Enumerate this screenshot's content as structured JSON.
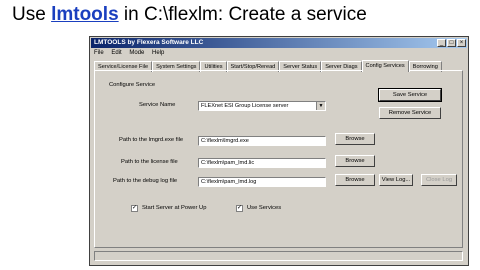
{
  "heading": {
    "prefix": "Use ",
    "link": "lmtools",
    "suffix": " in C:\\flexlm: Create a service"
  },
  "window": {
    "title": "LMTOOLS by Flexera Software LLC",
    "controls": {
      "minimize": "_",
      "maximize": "□",
      "close": "×"
    }
  },
  "menu": [
    "File",
    "Edit",
    "Mode",
    "Help"
  ],
  "tabs": [
    "Service/License File",
    "System Settings",
    "Utilities",
    "Start/Stop/Reread",
    "Server Status",
    "Server Diags",
    "Config Services",
    "Borrowing"
  ],
  "active_tab": "Config Services",
  "config": {
    "group_label": "Configure Service",
    "service_name_label": "Service Name",
    "service_name_value": "FLEXnet ESI Group License server",
    "lmgrd_label": "Path to the lmgrd.exe file",
    "lmgrd_value": "C:\\flexlm\\lmgrd.exe",
    "license_label": "Path to the license file",
    "license_value": "C:\\flexlm\\pam_lmd.lic",
    "debug_label": "Path to the debug log file",
    "debug_value": "C:\\flexlm\\pam_lmd.log",
    "save_service": "Save Service",
    "remove_service": "Remove Service",
    "browse": "Browse",
    "view_log": "View Log...",
    "close_log": "Close Log",
    "start_at_power_up_label": "Start Server at Power Up",
    "use_services_label": "Use Services",
    "start_at_power_up_checked": true,
    "use_services_checked": true
  }
}
